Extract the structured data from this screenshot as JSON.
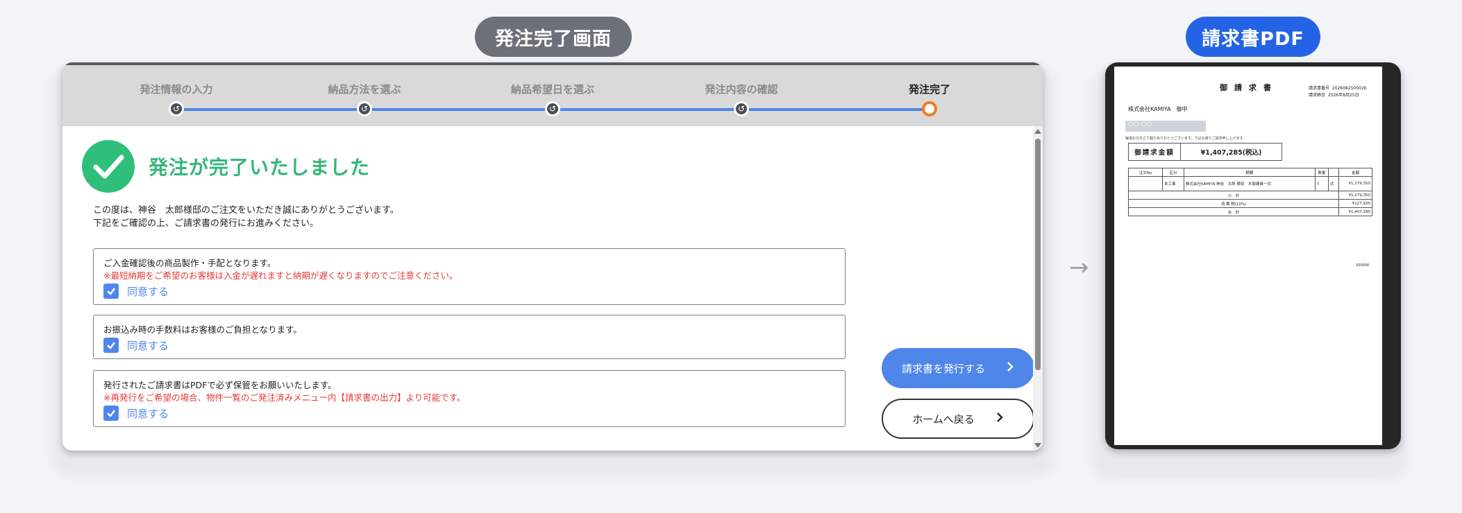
{
  "labels": {
    "left": "発注完了画面",
    "right": "請求書PDF"
  },
  "steps": [
    {
      "label": "発注情報の入力"
    },
    {
      "label": "納品方法を選ぶ"
    },
    {
      "label": "納品希望日を選ぶ"
    },
    {
      "label": "発注内容の確認"
    },
    {
      "label": "発注完了"
    }
  ],
  "main": {
    "title": "発注が完了いたしました",
    "intro1": "この度は、神谷　太郎様邸のご注文をいただき誠にありがとうございます。",
    "intro2": "下記をご確認の上、ご請求書の発行にお進みください。",
    "notices": [
      {
        "text": "ご入金確認後の商品製作・手配となります。",
        "warn": "※最短納期をご希望のお客様は入金が遅れますと納期が遅くなりますのでご注意ください。",
        "agree": "同意する"
      },
      {
        "text": "お振込み時の手数料はお客様のご負担となります。",
        "agree": "同意する"
      },
      {
        "text": "発行されたご請求書はPDFで必ず保管をお願いいたします。",
        "warn": "※再発行をご希望の場合、物件一覧のご発注済みメニュー内【請求書の出力】より可能です。",
        "agree": "同意する"
      }
    ],
    "buttons": {
      "invoice": "請求書を発行する",
      "home": "ホームへ戻る"
    }
  },
  "pdf": {
    "title": "御請求書",
    "invoice_no_label": "請求書番号",
    "invoice_no": "202608250002K",
    "date_label": "請求締日",
    "date": "2026年8月25日",
    "client": "株式会社KAMIYA　御中",
    "seal": "○○ ○○",
    "note": "毎度お引き立て賜りありがとうございます。下記の通りご請求申し上げます。",
    "total_label": "御請求金額",
    "total_value": "¥1,407,285(税込)",
    "table_headers": [
      "注文No",
      "区分",
      "摘要",
      "数量",
      "",
      "金額"
    ],
    "row": [
      "",
      "本工事",
      "株式会社KAMIYA 神谷　太郎 様邸　木製建具一式",
      "1",
      "式",
      "¥1,279,350"
    ],
    "subtotal_label": "小　計",
    "subtotal": "¥1,279,350",
    "tax_label": "消 費 税(10%)",
    "tax": "¥127,935",
    "grand_label": "合　計",
    "grand": "¥1,407,285",
    "footer": "200000"
  }
}
